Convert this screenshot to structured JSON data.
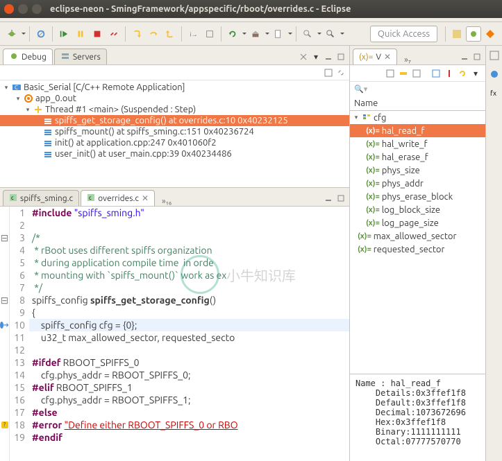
{
  "window": {
    "title": "eclipse-neon - SmingFramework/appspecific/rboot/overrides.c - Eclipse"
  },
  "quick_access": "Quick Access",
  "debug_view": {
    "tab1": "Debug",
    "tab2": "Servers",
    "launch": "Basic_Serial [C/C++ Remote Application]",
    "process": "app_0.out",
    "thread": "Thread #1 <main> (Suspended : Step)",
    "frames": [
      "spiffs_get_storage_config() at overrides.c:10 0x40232125",
      "spiffs_mount() at spiffs_sming.c:151 0x40236724",
      "init() at application.cpp:247 0x401060f2",
      "user_init() at user_main.cpp:39 0x40234486"
    ]
  },
  "editor": {
    "tab1": "spiffs_sming.c",
    "tab2": "overrides.c",
    "more": "»₁₆",
    "lines": [
      "1",
      "2",
      "3",
      "4",
      "5",
      "6",
      "7",
      "8",
      "9",
      "10",
      "11",
      "12",
      "13",
      "14",
      "15",
      "16",
      "17",
      "18",
      "19"
    ],
    "code": {
      "l1_pp": "#include",
      "l1_str": "\"spiffs_sming.h\"",
      "l3": "/*",
      "l4": " * rBoot uses different spiffs organization",
      "l5": " * during application compile time  in orde",
      "l6": " * mounting with `spiffs_mount()` work as ex",
      "l7": " */",
      "l8a": "spiffs_config ",
      "l8b": "spiffs_get_storage_config",
      "l8c": "()",
      "l9": "{",
      "l10": "    spiffs_config cfg = {0};",
      "l11": "    u32_t max_allowed_sector, requested_secto",
      "l13_pp": "#ifdef",
      "l13_m": " RBOOT_SPIFFS_0",
      "l14": "    cfg.phys_addr = RBOOT_SPIFFS_0;",
      "l15_pp": "#elif",
      "l15_m": " RBOOT_SPIFFS_1",
      "l16": "    cfg.phys_addr = RBOOT_SPIFFS_1;",
      "l17": "#else",
      "l18_pp": "#error",
      "l18_err": "\"Define either RBOOT_SPIFFS_0 or RBO",
      "l19": "#endif"
    }
  },
  "vars_view": {
    "tab1": "V",
    "more": "»₇",
    "col1": "Name",
    "root": "cfg",
    "items": [
      "hal_read_f",
      "hal_write_f",
      "hal_erase_f",
      "phys_size",
      "phys_addr",
      "phys_erase_block",
      "log_block_size",
      "log_page_size",
      "max_allowed_sector",
      "requested_sector"
    ],
    "details": "Name : hal_read_f\n    Details:0x3ffef1f8\n    Default:0x3ffef1f8\n    Decimal:1073672696\n    Hex:0x3ffef1f8\n    Binary:1111111111\n    Octal:07777570770"
  },
  "watermark": "小牛知识库",
  "chart_data": null
}
